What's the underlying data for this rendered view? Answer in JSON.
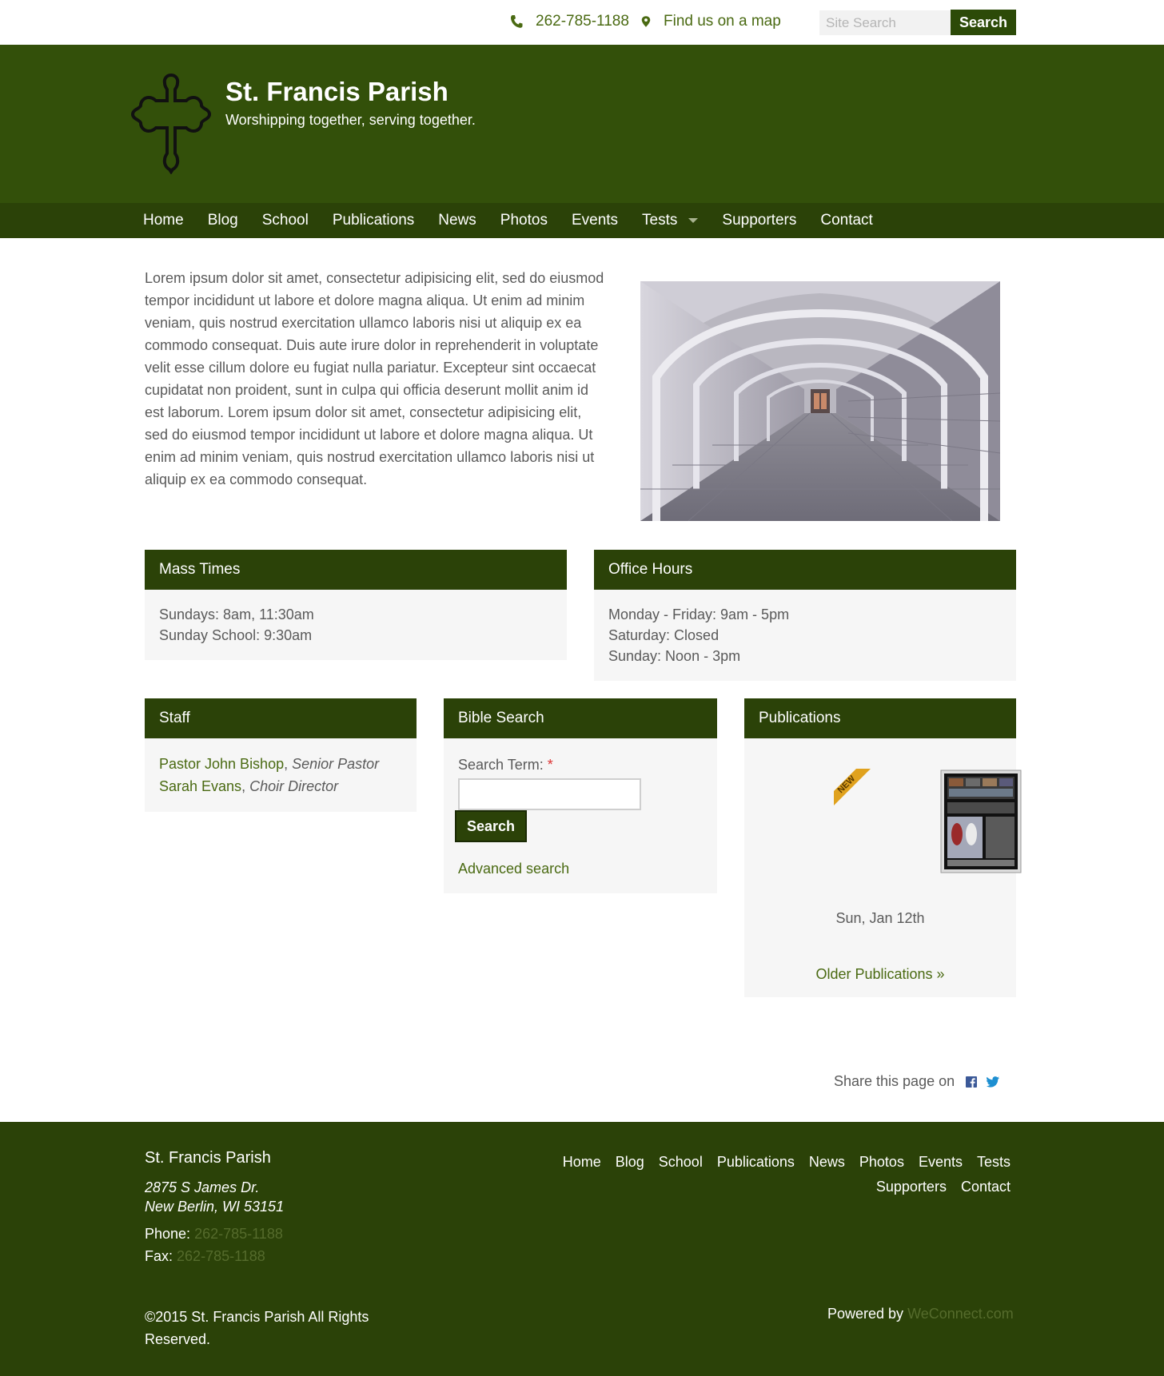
{
  "topbar": {
    "phone": "262-785-1188",
    "map_link": "Find us on a map",
    "search_placeholder": "Site Search",
    "search_button": "Search"
  },
  "header": {
    "title": "St. Francis Parish",
    "tagline": "Worshipping together, serving together."
  },
  "nav": {
    "items": [
      "Home",
      "Blog",
      "School",
      "Publications",
      "News",
      "Photos",
      "Events",
      "Tests",
      "Supporters",
      "Contact"
    ]
  },
  "intro": {
    "text": "Lorem ipsum dolor sit amet, consectetur adipisicing elit, sed do eiusmod tempor incididunt ut labore et dolore magna aliqua. Ut enim ad minim veniam, quis nostrud exercitation ullamco laboris nisi ut aliquip ex ea commodo consequat. Duis aute irure dolor in reprehenderit in voluptate velit esse cillum dolore eu fugiat nulla pariatur. Excepteur sint occaecat cupidatat non proident, sunt in culpa qui officia deserunt mollit anim id est laborum. Lorem ipsum dolor sit amet, consectetur adipisicing elit, sed do eiusmod tempor incididunt ut labore et dolore magna aliqua. Ut enim ad minim veniam, quis nostrud exercitation ullamco laboris nisi ut aliquip ex ea commodo consequat."
  },
  "mass_times": {
    "title": "Mass Times",
    "lines": [
      "Sundays: 8am, 11:30am",
      "Sunday School: 9:30am"
    ]
  },
  "office_hours": {
    "title": "Office Hours",
    "lines": [
      "Monday - Friday: 9am - 5pm",
      "Saturday: Closed",
      "Sunday: Noon - 3pm"
    ]
  },
  "staff": {
    "title": "Staff",
    "members": [
      {
        "name": "Pastor John Bishop",
        "sep": ", ",
        "role": "Senior Pastor"
      },
      {
        "name": "Sarah Evans",
        "sep": ", ",
        "role": "Choir Director"
      }
    ]
  },
  "bible_search": {
    "title": "Bible Search",
    "label": "Search Term:",
    "required_mark": "*",
    "button": "Search",
    "advanced_link": "Advanced search"
  },
  "publications": {
    "title": "Publications",
    "badge": "NEW",
    "date": "Sun, Jan 12th",
    "older_link": "Older Publications »"
  },
  "share": {
    "label": "Share this page on"
  },
  "footer": {
    "name": "St. Francis Parish",
    "address_line1": "2875 S James Dr.",
    "address_line2": "New Berlin, WI 53151",
    "phone_label": "Phone:",
    "phone": "262-785-1188",
    "fax_label": "Fax:",
    "fax": "262-785-1188",
    "nav": [
      "Home",
      "Blog",
      "School",
      "Publications",
      "News",
      "Photos",
      "Events",
      "Tests",
      "Supporters",
      "Contact"
    ],
    "copyright": "©2015 St. Francis Parish All Rights Reserved.",
    "powered_label": "Powered by",
    "powered_link": "WeConnect.com"
  },
  "colors": {
    "header_green": "#33500a",
    "nav_green": "#2b4208",
    "link_green": "#4a6a12"
  }
}
